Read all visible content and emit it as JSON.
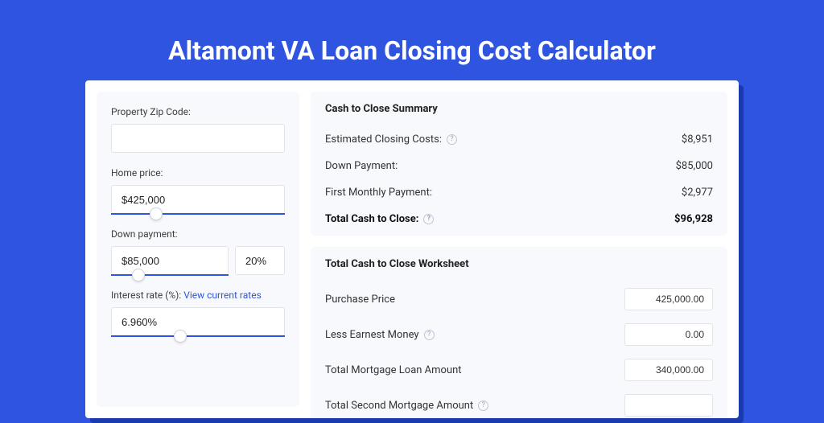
{
  "title": "Altamont VA Loan Closing Cost Calculator",
  "left": {
    "zip": {
      "label": "Property Zip Code:",
      "value": ""
    },
    "home_price": {
      "label": "Home price:",
      "value": "$425,000",
      "thumb_pct": 22
    },
    "down_payment": {
      "label": "Down payment:",
      "value": "$85,000",
      "pct": "20%",
      "thumb_pct": 18
    },
    "interest": {
      "label": "Interest rate (%):",
      "link": "View current rates",
      "value": "6.960%",
      "thumb_pct": 36
    }
  },
  "summary": {
    "title": "Cash to Close Summary",
    "rows": [
      {
        "label": "Estimated Closing Costs:",
        "help": true,
        "value": "$8,951",
        "bold": false
      },
      {
        "label": "Down Payment:",
        "help": false,
        "value": "$85,000",
        "bold": false
      },
      {
        "label": "First Monthly Payment:",
        "help": false,
        "value": "$2,977",
        "bold": false
      },
      {
        "label": "Total Cash to Close:",
        "help": true,
        "value": "$96,928",
        "bold": true
      }
    ]
  },
  "worksheet": {
    "title": "Total Cash to Close Worksheet",
    "rows": [
      {
        "label": "Purchase Price",
        "help": false,
        "value": "425,000.00"
      },
      {
        "label": "Less Earnest Money",
        "help": true,
        "value": "0.00"
      },
      {
        "label": "Total Mortgage Loan Amount",
        "help": false,
        "value": "340,000.00"
      },
      {
        "label": "Total Second Mortgage Amount",
        "help": true,
        "value": ""
      }
    ]
  }
}
